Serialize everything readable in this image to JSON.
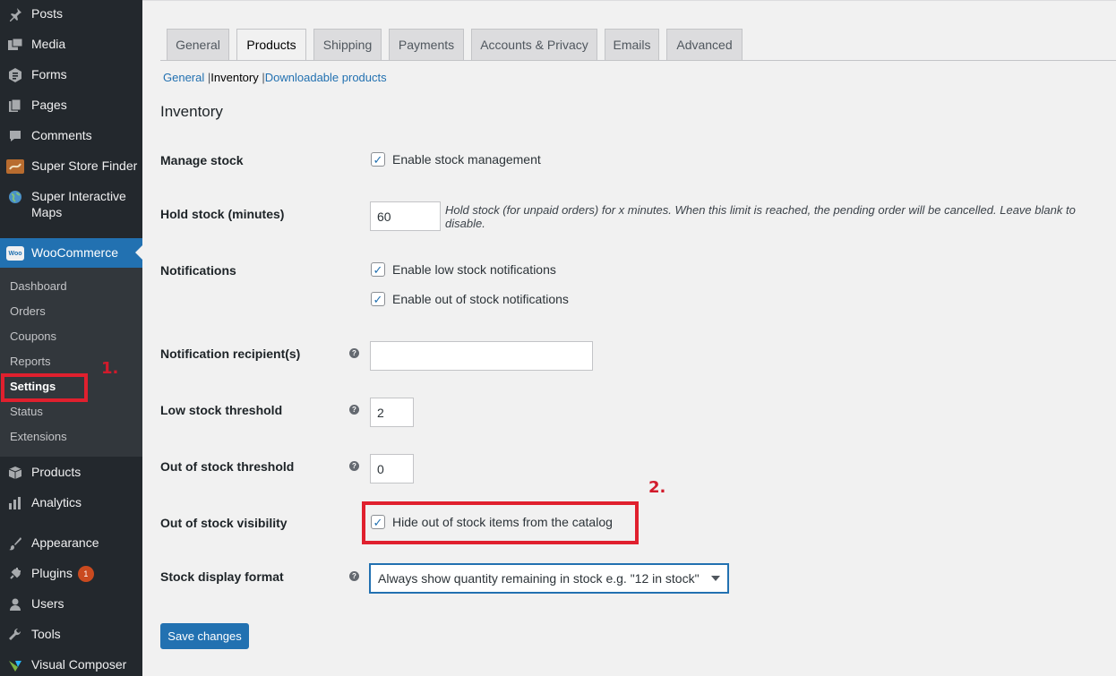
{
  "sidebar": {
    "items": [
      {
        "label": "Posts",
        "icon": "pin-icon"
      },
      {
        "label": "Media",
        "icon": "media-icon"
      },
      {
        "label": "Forms",
        "icon": "forms-icon"
      },
      {
        "label": "Pages",
        "icon": "pages-icon"
      },
      {
        "label": "Comments",
        "icon": "comments-icon"
      },
      {
        "label": "Super Store Finder",
        "icon": "store-finder-icon"
      },
      {
        "label": "Super Interactive Maps",
        "icon": "globe-icon"
      },
      {
        "label": "WooCommerce",
        "icon": "woocommerce-icon"
      },
      {
        "label": "Products",
        "icon": "box-icon"
      },
      {
        "label": "Analytics",
        "icon": "bar-chart-icon"
      },
      {
        "label": "Appearance",
        "icon": "paintbrush-icon"
      },
      {
        "label": "Plugins",
        "icon": "plug-icon",
        "badge": "1"
      },
      {
        "label": "Users",
        "icon": "user-icon"
      },
      {
        "label": "Tools",
        "icon": "wrench-icon"
      },
      {
        "label": "Visual Composer",
        "icon": "visual-composer-icon"
      }
    ],
    "woo_logo_text": "Woo",
    "submenu": [
      "Dashboard",
      "Orders",
      "Coupons",
      "Reports",
      "Settings",
      "Status",
      "Extensions"
    ],
    "current_submenu": "Settings"
  },
  "annotations": {
    "step1": "1.",
    "step2": "2.",
    "color": "#e0202e"
  },
  "tabs": [
    "General",
    "Products",
    "Shipping",
    "Payments",
    "Accounts & Privacy",
    "Emails",
    "Advanced"
  ],
  "active_tab": "Products",
  "subsections": {
    "general": "General",
    "sep1": "|",
    "inventory": "Inventory",
    "sep2": "|",
    "downloadable": "Downloadable products"
  },
  "section_title": "Inventory",
  "form": {
    "manage_stock": {
      "label": "Manage stock",
      "checkbox": "Enable stock management",
      "checked": true
    },
    "hold_stock": {
      "label": "Hold stock (minutes)",
      "value": "60",
      "description": "Hold stock (for unpaid orders) for x minutes. When this limit is reached, the pending order will be cancelled. Leave blank to disable."
    },
    "notifications": {
      "label": "Notifications",
      "low_stock": "Enable low stock notifications",
      "out_of_stock": "Enable out of stock notifications"
    },
    "recipient": {
      "label": "Notification recipient(s)",
      "value": ""
    },
    "low_threshold": {
      "label": "Low stock threshold",
      "value": "2"
    },
    "out_threshold": {
      "label": "Out of stock threshold",
      "value": "0"
    },
    "visibility": {
      "label": "Out of stock visibility",
      "checkbox": "Hide out of stock items from the catalog",
      "checked": true
    },
    "display_format": {
      "label": "Stock display format",
      "value": "Always show quantity remaining in stock e.g. \"12 in stock\""
    },
    "help_glyph": "?",
    "check_glyph": "✓"
  },
  "save_button": "Save changes",
  "colors": {
    "accent": "#2271b1",
    "sidebar_bg": "#23282d",
    "annotation": "#e0202e"
  }
}
